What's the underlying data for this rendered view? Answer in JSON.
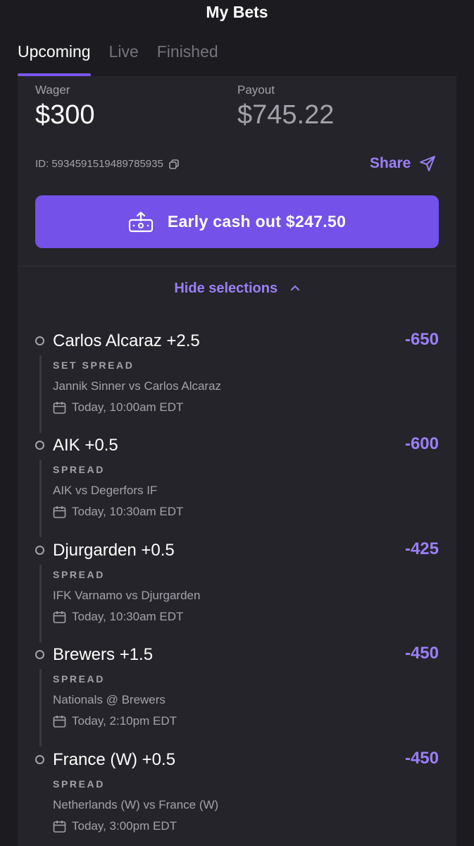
{
  "header": {
    "title": "My Bets"
  },
  "tabs": [
    {
      "label": "Upcoming",
      "active": true
    },
    {
      "label": "Live",
      "active": false
    },
    {
      "label": "Finished",
      "active": false
    }
  ],
  "bet": {
    "wager_label": "Wager",
    "wager_value": "$300",
    "payout_label": "Payout",
    "payout_value": "$745.22",
    "id_text": "ID: 5934591519489785935",
    "share_label": "Share",
    "cashout_label": "Early cash out $247.50",
    "hide_selections_label": "Hide selections"
  },
  "selections": [
    {
      "name": "Carlos Alcaraz +2.5",
      "odds": "-650",
      "market": "SET SPREAD",
      "match": "Jannik Sinner vs Carlos Alcaraz",
      "time": "Today, 10:00am EDT"
    },
    {
      "name": "AIK +0.5",
      "odds": "-600",
      "market": "SPREAD",
      "match": "AIK vs Degerfors IF",
      "time": "Today, 10:30am EDT"
    },
    {
      "name": "Djurgarden +0.5",
      "odds": "-425",
      "market": "SPREAD",
      "match": "IFK Varnamo vs Djurgarden",
      "time": "Today, 10:30am EDT"
    },
    {
      "name": "Brewers +1.5",
      "odds": "-450",
      "market": "SPREAD",
      "match": "Nationals @ Brewers",
      "time": "Today, 2:10pm EDT"
    },
    {
      "name": "France (W) +0.5",
      "odds": "-450",
      "market": "SPREAD",
      "match": "Netherlands (W) vs France (W)",
      "time": "Today, 3:00pm EDT"
    }
  ],
  "icons": {
    "copy": "copy-icon",
    "share": "send-icon",
    "cashout": "cash-out-icon",
    "chevron": "chevron-up-icon",
    "calendar": "calendar-icon",
    "status": "circle-icon"
  },
  "colors": {
    "background": "#1c1b1f",
    "card": "#25242a",
    "accent": "#7451e8",
    "accent_text": "#9b7ff5",
    "muted_text": "#a4a1ab"
  }
}
